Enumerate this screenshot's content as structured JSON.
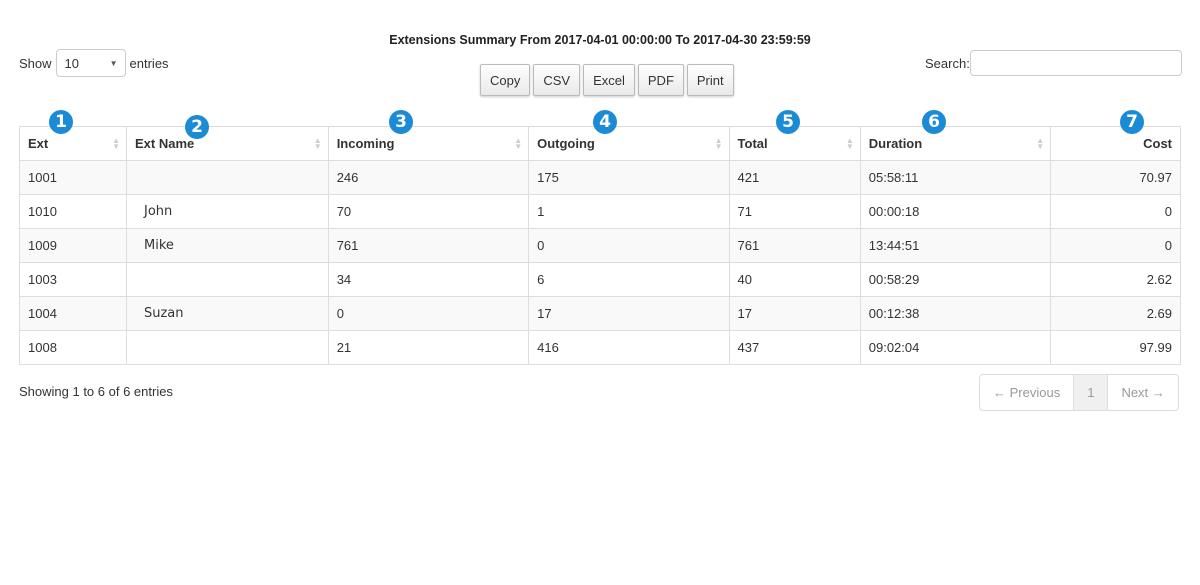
{
  "title": "Extensions Summary From 2017-04-01 00:00:00 To 2017-04-30 23:59:59",
  "length": {
    "show_label": "Show",
    "value": "10",
    "entries_label": "entries"
  },
  "buttons": {
    "copy": "Copy",
    "csv": "CSV",
    "excel": "Excel",
    "pdf": "PDF",
    "print": "Print"
  },
  "search": {
    "label": "Search:",
    "value": ""
  },
  "badges": [
    "1",
    "2",
    "3",
    "4",
    "5",
    "6",
    "7"
  ],
  "table": {
    "headers": [
      "Ext",
      "Ext Name",
      "Incoming",
      "Outgoing",
      "Total",
      "Duration",
      "Cost"
    ],
    "rows": [
      [
        "1001",
        "",
        "246",
        "175",
        "421",
        "05:58:11",
        "70.97"
      ],
      [
        "1010",
        "John",
        "70",
        "1",
        "71",
        "00:00:18",
        "0"
      ],
      [
        "1009",
        "Mike",
        "761",
        "0",
        "761",
        "13:44:51",
        "0"
      ],
      [
        "1003",
        "",
        "34",
        "6",
        "40",
        "00:58:29",
        "2.62"
      ],
      [
        "1004",
        "Suzan",
        "0",
        "17",
        "17",
        "00:12:38",
        "2.69"
      ],
      [
        "1008",
        "",
        "21",
        "416",
        "437",
        "09:02:04",
        "97.99"
      ]
    ]
  },
  "info": "Showing 1 to 6 of 6 entries",
  "pager": {
    "previous": "← Previous",
    "page": "1",
    "next": "Next →"
  },
  "colors": {
    "badge": "#1c8bd6"
  }
}
